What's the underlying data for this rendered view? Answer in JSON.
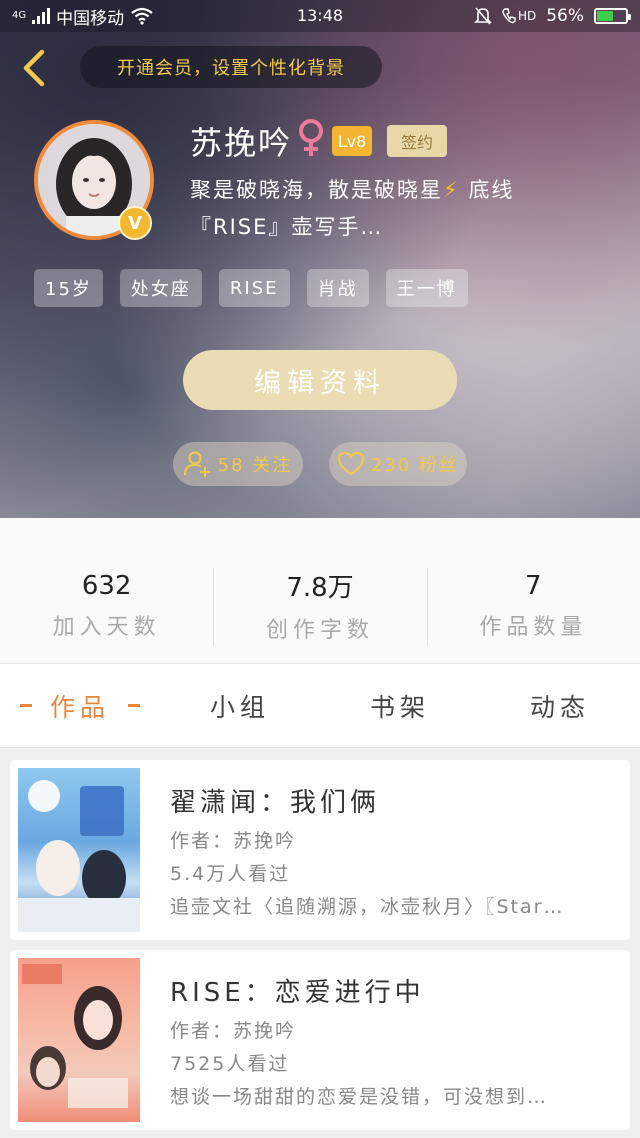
{
  "status_bar": {
    "network_type": "4G",
    "carrier": "中国移动",
    "time": "13:48",
    "hd_label": "HD",
    "battery_percent": "56%",
    "battery_level": 0.56
  },
  "header": {
    "vip_banner": "开通会员，设置个性化背景",
    "username": "苏挽吟",
    "level": "Lv8",
    "signed_badge": "签约",
    "vip_badge": "V",
    "bio_line1_a": "聚是破晓海，散是破晓星",
    "bio_line1_b": "底线",
    "bio_line2": "『RISE』壶写手…",
    "tags": [
      "15岁",
      "处女座",
      "RISE",
      "肖战",
      "王一博"
    ],
    "edit_button": "编辑资料",
    "following_label": "58 关注",
    "fans_label": "230 粉丝"
  },
  "stats": [
    {
      "value": "632",
      "label": "加入天数"
    },
    {
      "value": "7.8万",
      "label": "创作字数"
    },
    {
      "value": "7",
      "label": "作品数量"
    }
  ],
  "tabs": [
    {
      "label": "作品",
      "active": true
    },
    {
      "label": "小组",
      "active": false
    },
    {
      "label": "书架",
      "active": false
    },
    {
      "label": "动态",
      "active": false
    }
  ],
  "works": [
    {
      "title": "翟潇闻：我们俩",
      "author": "作者：苏挽吟",
      "views": "5.4万人看过",
      "description": "追壶文社〈追随溯源，冰壶秋月〉〖Star…"
    },
    {
      "title": "RISE：恋爱进行中",
      "author": "作者：苏挽吟",
      "views": "7525人看过",
      "description": "想谈一场甜甜的恋爱是没错，可没想到…"
    }
  ],
  "colors": {
    "accent": "#e8873f",
    "gold": "#f2c94c",
    "edit_button_bg": "#ebdcb3",
    "level_badge": "#f4b533"
  }
}
